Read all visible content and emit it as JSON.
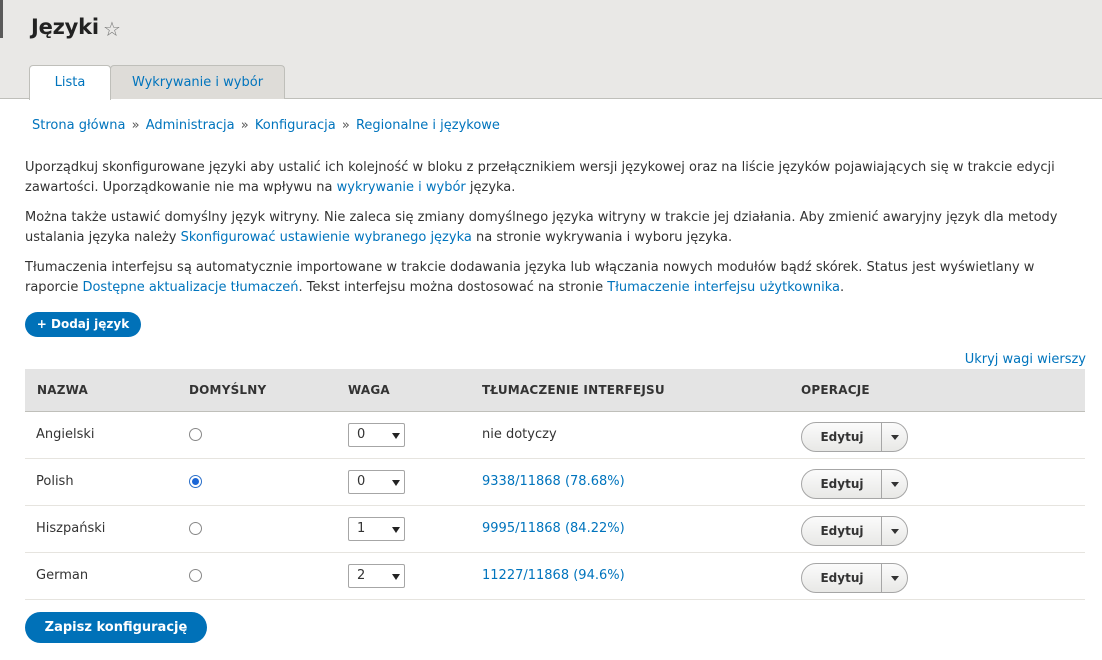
{
  "page": {
    "title": "Języki",
    "star_icon": "☆"
  },
  "tabs": [
    {
      "label": "Lista"
    },
    {
      "label": "Wykrywanie i wybór"
    }
  ],
  "breadcrumb": {
    "items": [
      "Strona główna",
      "Administracja",
      "Konfiguracja",
      "Regionalne i językowe"
    ],
    "separator": "»"
  },
  "description": {
    "p1_text": "Uporządkuj skonfigurowane języki aby ustalić ich kolejność w bloku z przełącznikiem wersji językowej oraz na liście języków pojawiających się w trakcie edycji zawartości. Uporządkowanie nie ma wpływu na ",
    "p1_link": "wykrywanie i wybór",
    "p1_end": " języka.",
    "p2_text": "Można także ustawić domyślny język witryny. Nie zaleca się zmiany domyślnego języka witryny w trakcie jej działania. Aby zmienić awaryjny język dla metody ustalania języka należy ",
    "p2_link": "Skonfigurować ustawienie wybranego języka",
    "p2_end": " na stronie wykrywania i wyboru języka.",
    "p3_text": "Tłumaczenia interfejsu są automatycznie importowane w trakcie dodawania języka lub włączania nowych modułów bądź skórek. Status jest wyświetlany w raporcie ",
    "p3_link1": "Dostępne aktualizacje tłumaczeń",
    "p3_mid": ". Tekst interfejsu można dostosować na stronie ",
    "p3_link2": "Tłumaczenie interfejsu użytkownika",
    "p3_end": "."
  },
  "add_button": "+ Dodaj język",
  "toggle_weights": "Ukryj wagi wierszy",
  "table": {
    "headers": [
      "NAZWA",
      "DOMYŚLNY",
      "WAGA",
      "TŁUMACZENIE INTERFEJSU",
      "OPERACJE"
    ],
    "rows": [
      {
        "name": "Angielski",
        "default": false,
        "weight": "0",
        "translation": "nie dotyczy",
        "translation_is_link": false,
        "operation": "Edytuj"
      },
      {
        "name": "Polish",
        "default": true,
        "weight": "0",
        "translation": "9338/11868 (78.68%)",
        "translation_is_link": true,
        "operation": "Edytuj"
      },
      {
        "name": "Hiszpański",
        "default": false,
        "weight": "1",
        "translation": "9995/11868 (84.22%)",
        "translation_is_link": true,
        "operation": "Edytuj"
      },
      {
        "name": "German",
        "default": false,
        "weight": "2",
        "translation": "11227/11868 (94.6%)",
        "translation_is_link": true,
        "operation": "Edytuj"
      }
    ]
  },
  "save_button": "Zapisz konfigurację",
  "colors": {
    "primary_button": "#0071b8",
    "link": "#0074bd",
    "header_bg": "#e9e8e6",
    "table_header_bg": "#e4e4e4"
  }
}
